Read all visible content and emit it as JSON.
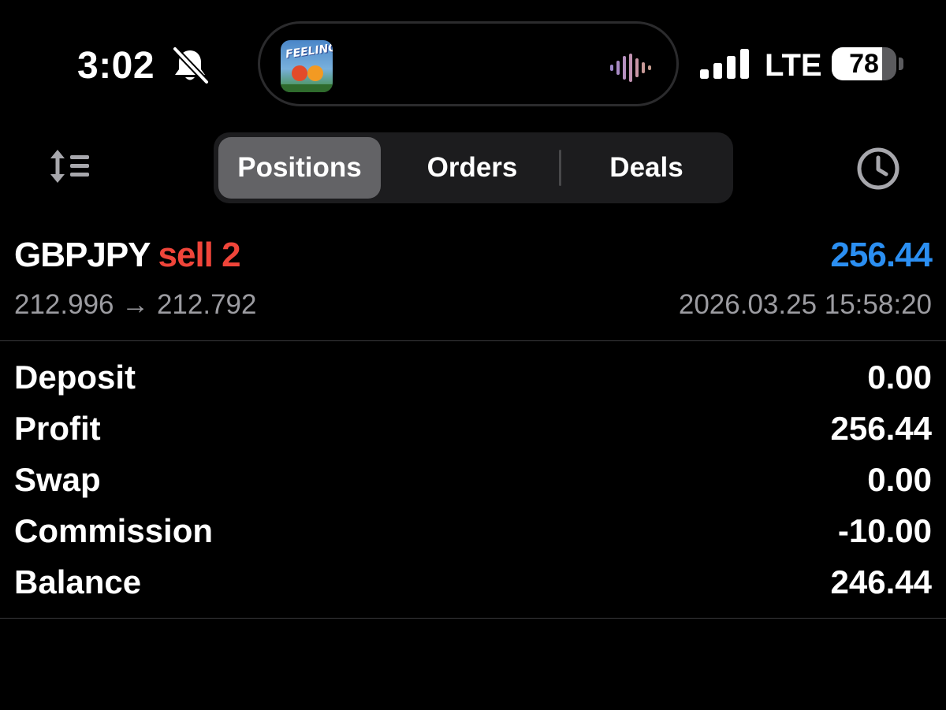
{
  "status_bar": {
    "time": "3:02",
    "silent_icon": "bell-slash-icon",
    "now_playing": {
      "album_text": "FEELING",
      "waveform_icon": "waveform-icon"
    },
    "signal_icon": "cellular-signal-icon",
    "network": "LTE",
    "battery_percent": "78",
    "battery_level": 0.78
  },
  "toolbar": {
    "sort_icon": "sort-list-icon",
    "tabs": [
      {
        "label": "Positions",
        "active": true
      },
      {
        "label": "Orders",
        "active": false
      },
      {
        "label": "Deals",
        "active": false
      }
    ],
    "history_icon": "clock-icon"
  },
  "position": {
    "symbol": "GBPJPY",
    "side": "sell 2",
    "profit": "256.44",
    "prices": "212.996 → 212.792",
    "time": "2026.03.25 15:58:20"
  },
  "summary": [
    {
      "label": "Deposit",
      "value": "0.00"
    },
    {
      "label": "Profit",
      "value": "256.44"
    },
    {
      "label": "Swap",
      "value": "0.00"
    },
    {
      "label": "Commission",
      "value": "-10.00"
    },
    {
      "label": "Balance",
      "value": "246.44"
    }
  ],
  "colors": {
    "sell": "#f0453a",
    "profit_positive": "#2b8ff2",
    "secondary_text": "#9c9ca1",
    "segment_active": "#636366",
    "segment_bg": "#1c1c1e"
  }
}
